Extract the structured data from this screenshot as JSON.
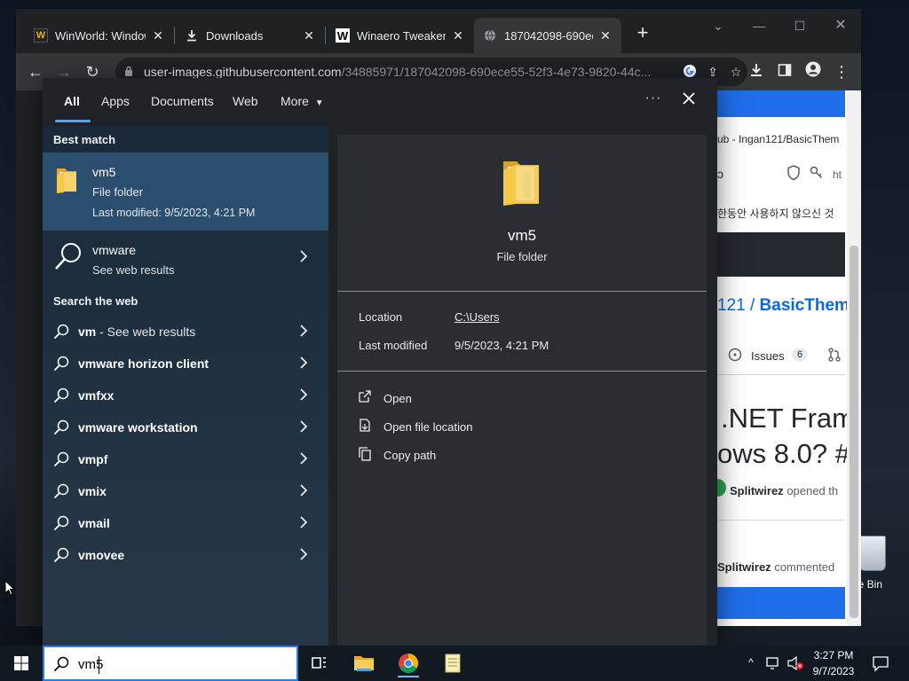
{
  "browser": {
    "tabs": [
      {
        "title": "WinWorld: Window",
        "favicon": "W"
      },
      {
        "title": "Downloads",
        "favicon": "download-icon"
      },
      {
        "title": "Winaero Tweaker",
        "favicon": "W"
      },
      {
        "title": "187042098-690ece",
        "favicon": "globe-icon"
      }
    ],
    "url_host": "user-images.githubusercontent.com",
    "url_path": "/34885971/187042098-690ece55-52f3-4e73-9820-44c..."
  },
  "page_behind": {
    "repo_breadcrumb": "ub - Ingan121/BasicThem",
    "korean_banner": "한동안 사용하지 않으신 것",
    "repo_path_prefix": "121 / ",
    "repo_name": "BasicThem",
    "issues_label": "Issues",
    "issues_count": "6",
    "issue_title_line1": ".NET Fram",
    "issue_title_line2": "ows 8.0? #",
    "opened_user": "Splitwirez",
    "opened_text": "opened th",
    "commented_user": "Splitwirez",
    "commented_text": "commented",
    "ht_text": "ht"
  },
  "search_panel": {
    "tabs": [
      "All",
      "Apps",
      "Documents",
      "Web",
      "More"
    ],
    "active_tab": "All",
    "best_match_heading": "Best match",
    "best_match": {
      "name": "vm5",
      "type": "File folder",
      "modified": "Last modified: 9/5/2023, 4:21 PM"
    },
    "web_result": {
      "term": "vmware",
      "sub": "See web results"
    },
    "search_web_heading": "Search the web",
    "suggestions": [
      {
        "bold": "vm",
        "rest": " - See web results"
      },
      {
        "bold": "vmware horizon client",
        "rest": ""
      },
      {
        "bold": "vmfxx",
        "rest": ""
      },
      {
        "bold": "vmware workstation",
        "rest": ""
      },
      {
        "bold": "vmpf",
        "rest": ""
      },
      {
        "bold": "vmix",
        "rest": ""
      },
      {
        "bold": "vmail",
        "rest": ""
      },
      {
        "bold": "vmovee",
        "rest": ""
      }
    ],
    "preview": {
      "name": "vm5",
      "type": "File folder",
      "location_label": "Location",
      "location_value": "C:\\Users",
      "modified_label": "Last modified",
      "modified_value": "9/5/2023, 4:21 PM",
      "actions": [
        "Open",
        "Open file location",
        "Copy path"
      ]
    }
  },
  "taskbar": {
    "search_value": "vm5",
    "time": "3:27 PM",
    "date": "9/7/2023"
  },
  "desktop": {
    "recycle_bin_label": "cle Bin"
  },
  "colors": {
    "accent": "#2d7de0",
    "best_match_bg": "#2b4d6e",
    "folder_yellow": "#f5c84c"
  }
}
